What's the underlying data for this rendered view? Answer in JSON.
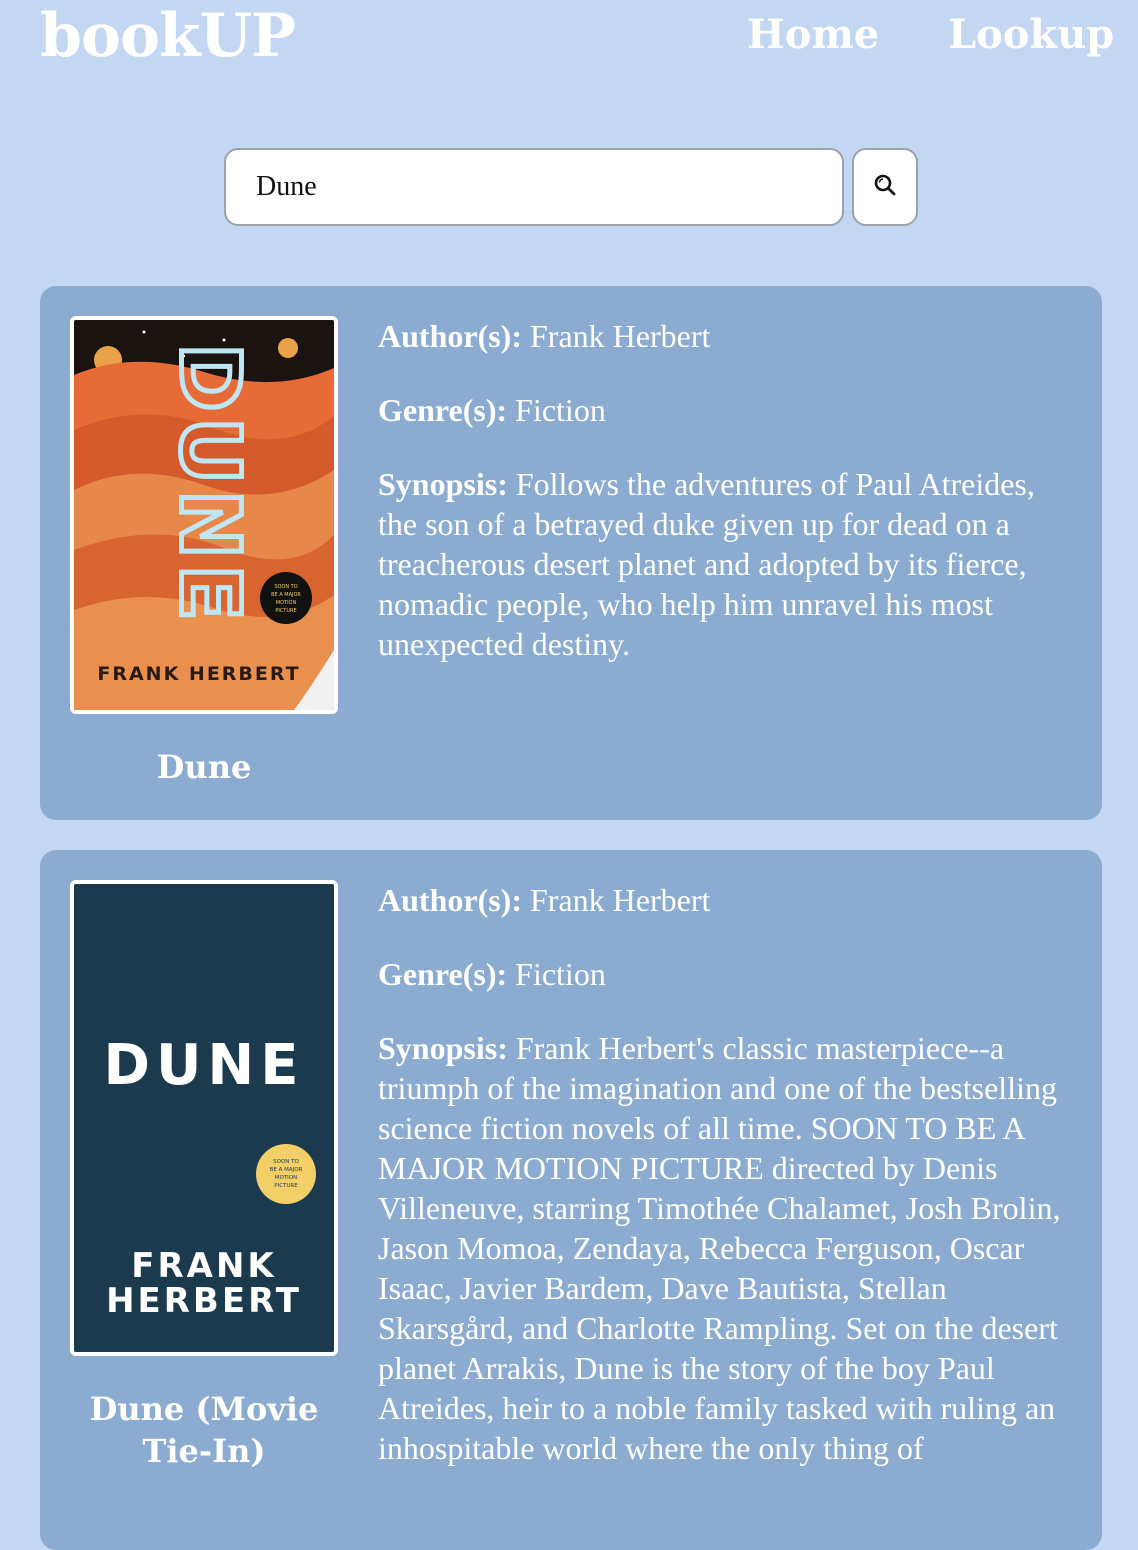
{
  "nav": {
    "brand": "bookUP",
    "links": [
      "Home",
      "Lookup"
    ]
  },
  "search": {
    "value": "Dune",
    "button_icon": "search-icon"
  },
  "labels": {
    "author": "Author(s):",
    "genre": "Genre(s):",
    "synopsis": "Synopsis:"
  },
  "books": [
    {
      "title": "Dune",
      "authors": "Frank Herbert",
      "genres": "Fiction",
      "synopsis": "Follows the adventures of Paul Atreides, the son of a betrayed duke given up for dead on a treacherous desert planet and adopted by its fierce, nomadic people, who help him unravel his most unexpected destiny.",
      "cover": {
        "title_text": "DUNE",
        "author_text": "FRANK HERBERT",
        "badge_text": [
          "SOON TO",
          "BE A MAJOR",
          "MOTION",
          "PICTURE"
        ]
      }
    },
    {
      "title": "Dune (Movie Tie-In)",
      "authors": "Frank Herbert",
      "genres": "Fiction",
      "synopsis": "Frank Herbert's classic masterpiece--a triumph of the imagination and one of the bestselling science fiction novels of all time. SOON TO BE A MAJOR MOTION PICTURE directed by Denis Villeneuve, starring Timothée Chalamet, Josh Brolin, Jason Momoa, Zendaya, Rebecca Ferguson, Oscar Isaac, Javier Bardem, Dave Bautista, Stellan Skarsgård, and Charlotte Rampling. Set on the desert planet Arrakis, Dune is the story of the boy Paul Atreides, heir to a noble family tasked with ruling an inhospitable world where the only thing of",
      "cover": {
        "title_text": "DUNE",
        "author_lines": [
          "FRANK",
          "HERBERT"
        ],
        "badge_text": [
          "SOON TO",
          "BE A MAJOR",
          "MOTION",
          "PICTURE"
        ]
      }
    }
  ],
  "colors": {
    "page_background": "#c3d7f2",
    "card_background": "#8bacd0",
    "text": "#ffffff",
    "cover1_orange": "#e2602f",
    "cover2_navy": "#1c3a4e",
    "badge_yellow": "#f3cf6a"
  }
}
